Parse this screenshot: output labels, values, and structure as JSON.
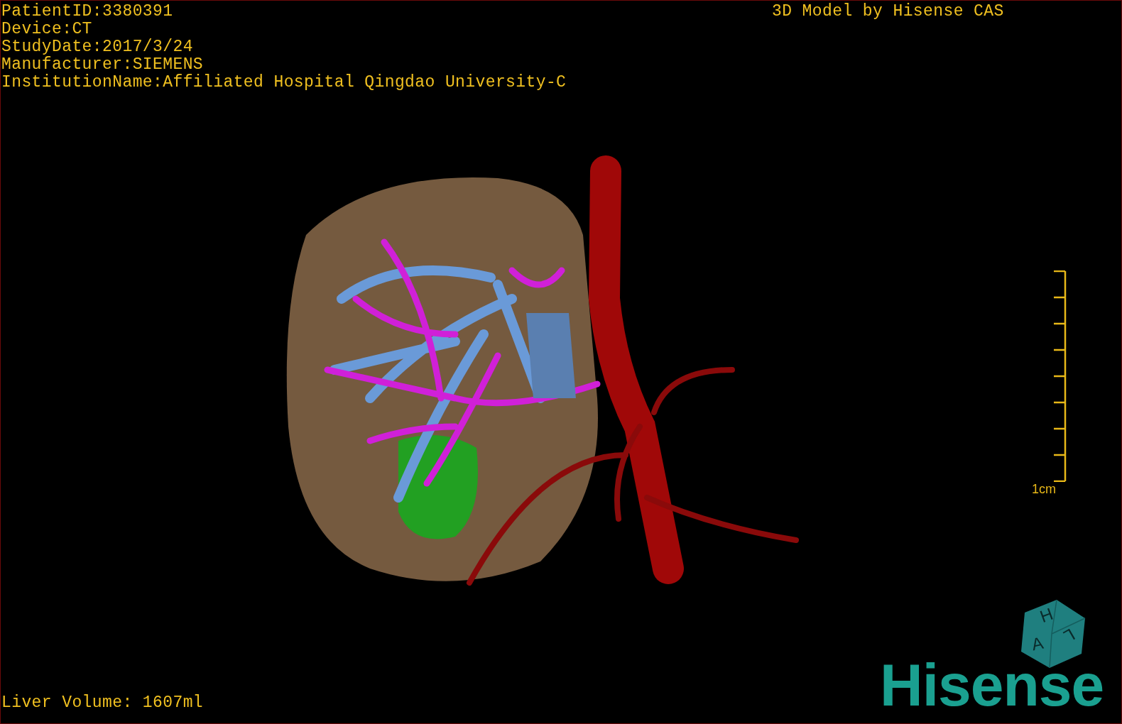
{
  "header_left": [
    "PatientID:3380391",
    "Device:CT",
    "StudyDate:2017/3/24",
    "Manufacturer:SIEMENS",
    "InstitutionName:Affiliated Hospital Qingdao University-C"
  ],
  "header_right": "3D Model by Hisense CAS",
  "scale_bar": {
    "label": "1cm"
  },
  "orientation_cube": {
    "faces": [
      "H",
      "A",
      "L"
    ]
  },
  "liver_volume": "Liver Volume: 1607ml",
  "logo": "Hisense"
}
